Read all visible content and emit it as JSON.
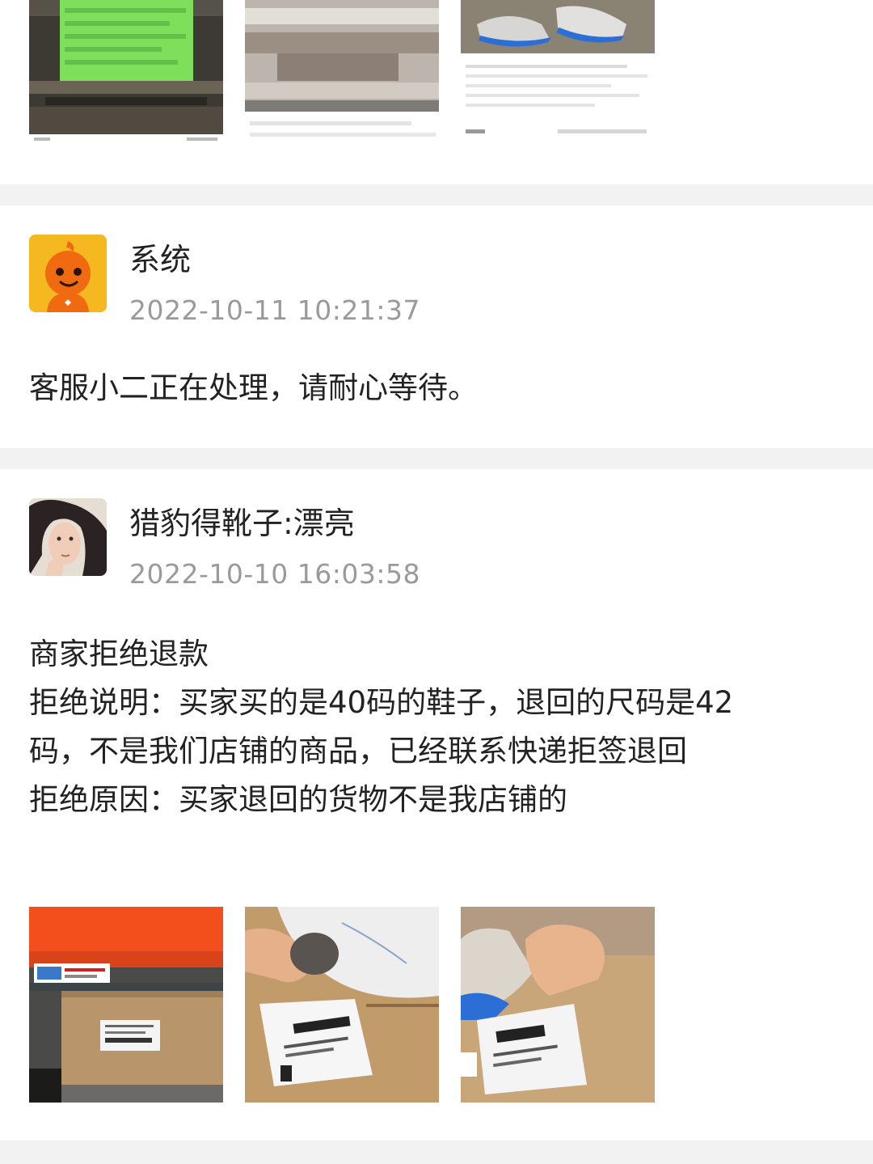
{
  "top_card": {
    "images": [
      "chat-screenshot-image",
      "blurred-photo-image",
      "shoe-listing-screenshot-image"
    ]
  },
  "system_post": {
    "author": "系统",
    "timestamp": "2022-10-11 10:21:37",
    "message": "客服小二正在处理，请耐心等待。",
    "avatar_icon": "taobao-mascot-icon",
    "avatar_color": "#f5b820"
  },
  "seller_post": {
    "author": "猎豹得靴子:漂亮",
    "timestamp": "2022-10-10 16:03:58",
    "lines": [
      "商家拒绝退款",
      "拒绝说明：买家买的是40码的鞋子，退回的尺码是42",
      "码，不是我们店铺的商品，已经联系快递拒签退回",
      "拒绝原因：买家退回的货物不是我店铺的"
    ],
    "images": [
      "shoebox-photo-image",
      "return-label-photo-image",
      "shoe-tag-photo-image"
    ]
  },
  "colors": {
    "background": "#f2f2f2",
    "card": "#ffffff",
    "timestamp": "#9a9a9a"
  }
}
